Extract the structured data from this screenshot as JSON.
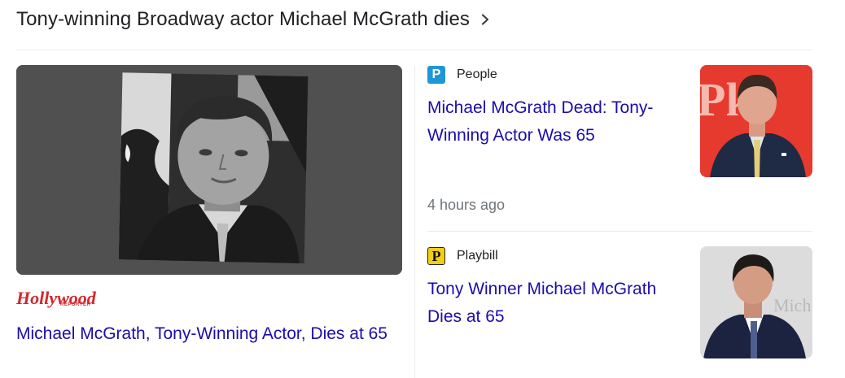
{
  "header": {
    "title": "Tony-winning Broadway actor Michael McGrath dies",
    "chevron_icon": "chevron-right-icon"
  },
  "main_story": {
    "publisher_logo_text": "Hollywood",
    "publisher_logo_subtext": "REPORTER",
    "headline": "Michael McGrath, Tony-Winning Actor, Dies at 65"
  },
  "side_stories": [
    {
      "favicon_letter": "P",
      "favicon_color": "#1f97d6",
      "source": "People",
      "headline": "Michael McGrath Dead: Tony-Winning Actor Was 65",
      "time": "4 hours ago",
      "thumb_text": "Pkz"
    },
    {
      "favicon_letter": "P",
      "favicon_color": "#f3ce17",
      "source": "Playbill",
      "headline": "Tony Winner Michael McGrath Dies at 65",
      "thumb_text": "Mich"
    }
  ],
  "colors": {
    "link": "#1a0dab",
    "text": "#202124",
    "meta": "#70757a",
    "divider": "#e8eaed",
    "hr_red": "#d6252b"
  }
}
